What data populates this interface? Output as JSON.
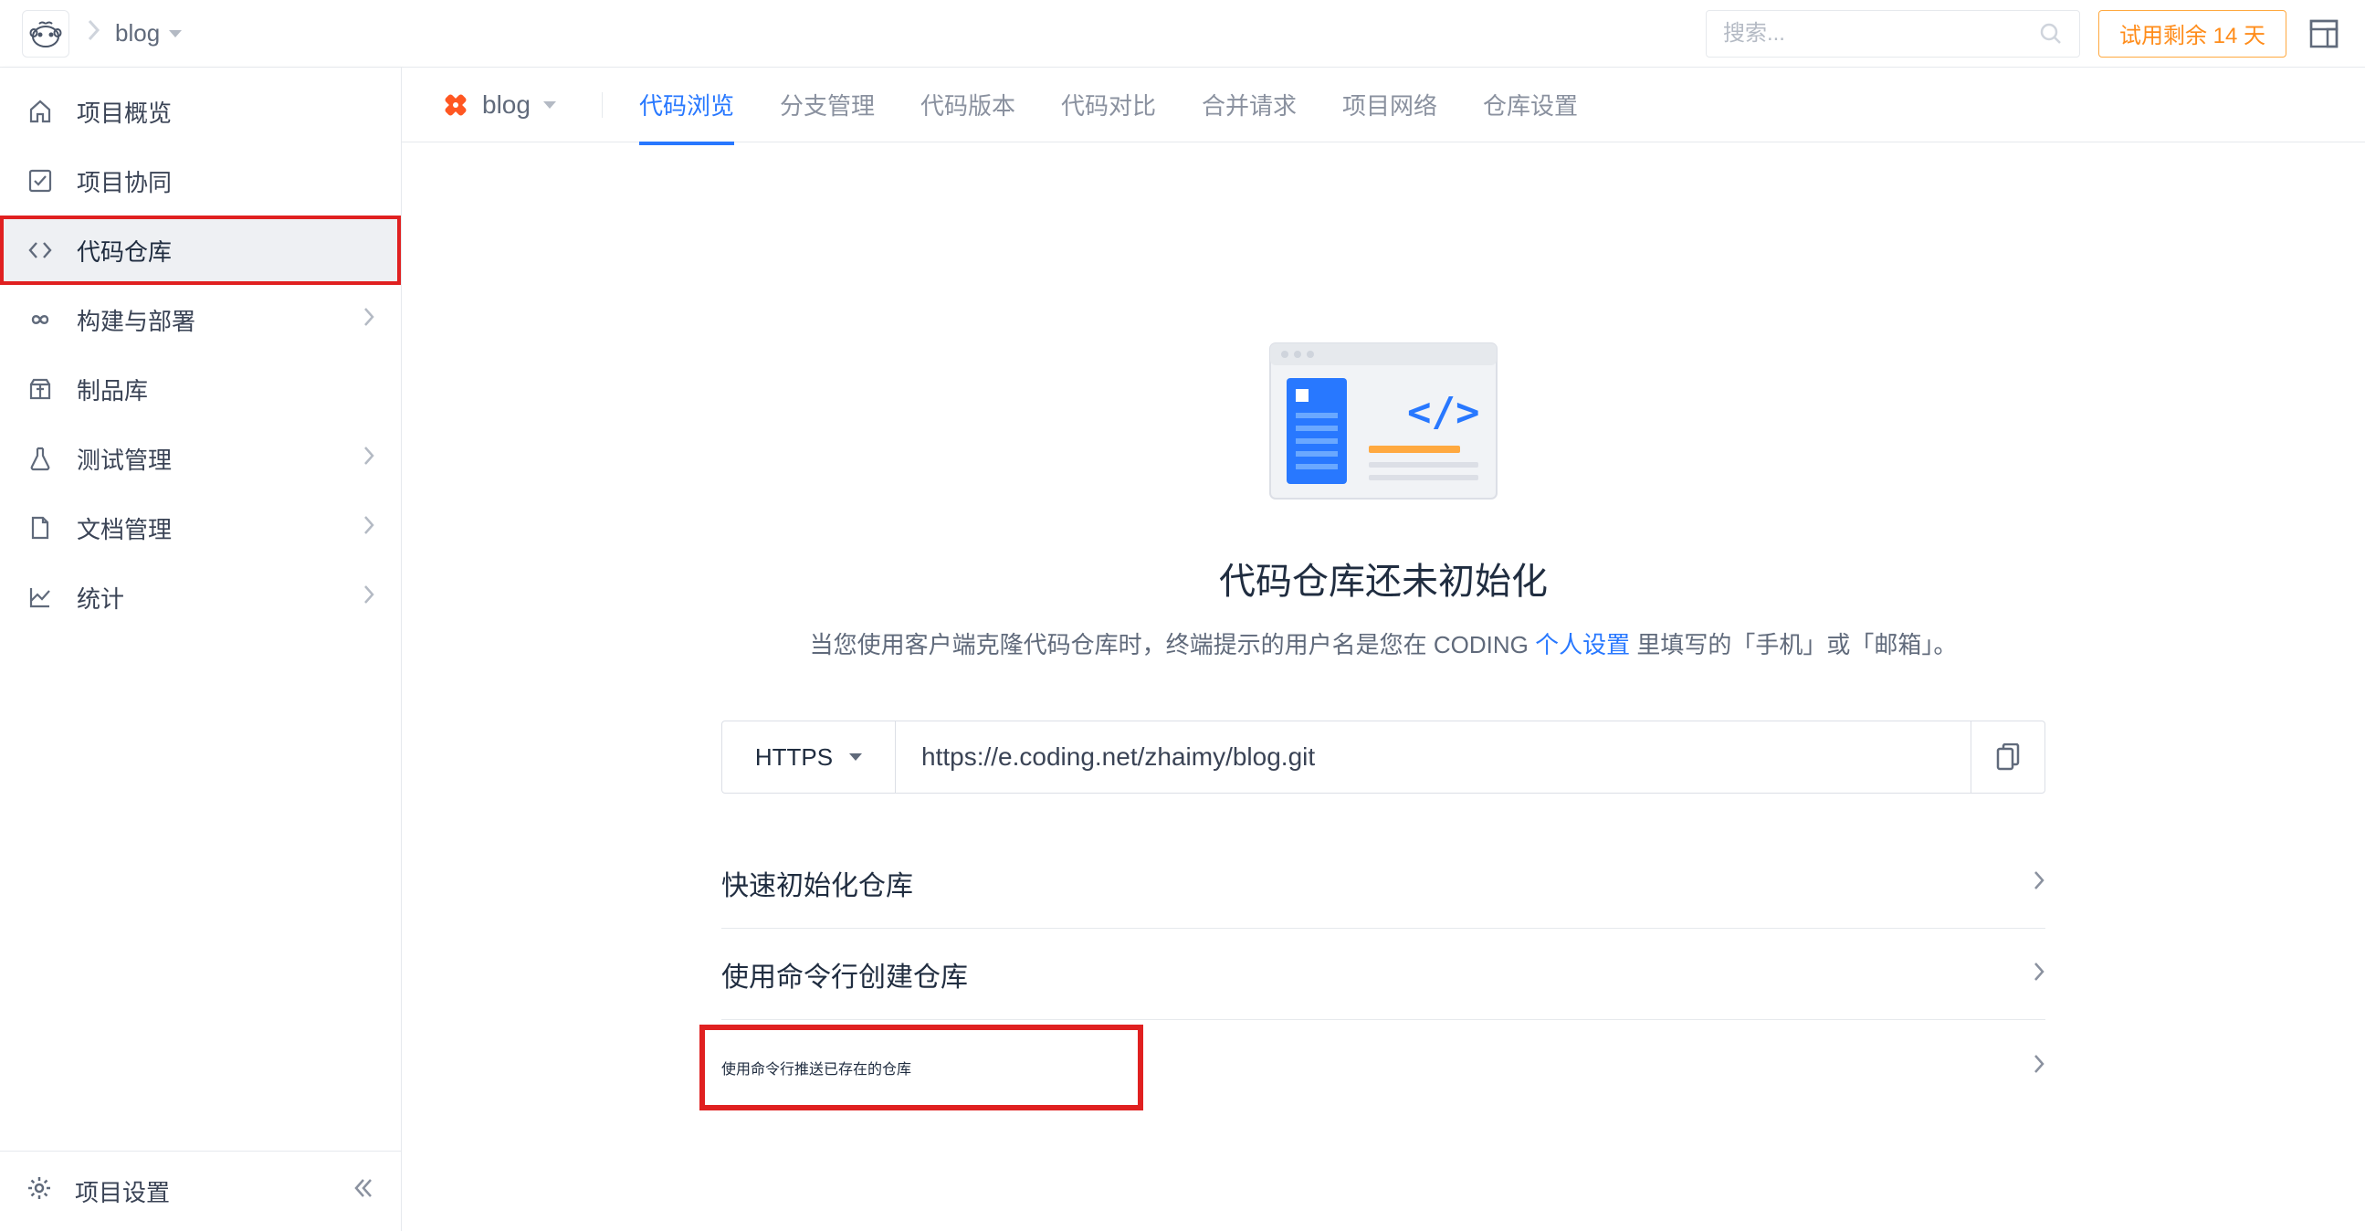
{
  "header": {
    "breadcrumb_current": "blog",
    "search_placeholder": "搜索...",
    "trial_text": "试用剩余 14 天"
  },
  "sidebar": {
    "items": [
      {
        "label": "项目概览",
        "icon": "home",
        "expandable": false
      },
      {
        "label": "项目协同",
        "icon": "check-square",
        "expandable": false
      },
      {
        "label": "代码仓库",
        "icon": "code",
        "expandable": false,
        "active": true,
        "highlighted": true
      },
      {
        "label": "构建与部署",
        "icon": "infinity",
        "expandable": true
      },
      {
        "label": "制品库",
        "icon": "package",
        "expandable": false
      },
      {
        "label": "测试管理",
        "icon": "flask",
        "expandable": true
      },
      {
        "label": "文档管理",
        "icon": "file",
        "expandable": true
      },
      {
        "label": "统计",
        "icon": "chart",
        "expandable": true
      }
    ],
    "footer_label": "项目设置"
  },
  "subheader": {
    "repo_name": "blog",
    "tabs": [
      {
        "label": "代码浏览",
        "active": true
      },
      {
        "label": "分支管理"
      },
      {
        "label": "代码版本"
      },
      {
        "label": "代码对比"
      },
      {
        "label": "合并请求"
      },
      {
        "label": "项目网络"
      },
      {
        "label": "仓库设置"
      }
    ]
  },
  "empty": {
    "title": "代码仓库还未初始化",
    "desc_pre": "当您使用客户端克隆代码仓库时，终端提示的用户名是您在 CODING ",
    "desc_link": "个人设置",
    "desc_post": " 里填写的「手机」或「邮箱」。",
    "protocol": "HTTPS",
    "url": "https://e.coding.net/zhaimy/blog.git",
    "accordion": [
      {
        "label": "快速初始化仓库"
      },
      {
        "label": "使用命令行创建仓库"
      },
      {
        "label": "使用命令行推送已存在的仓库",
        "highlighted": true
      }
    ]
  }
}
